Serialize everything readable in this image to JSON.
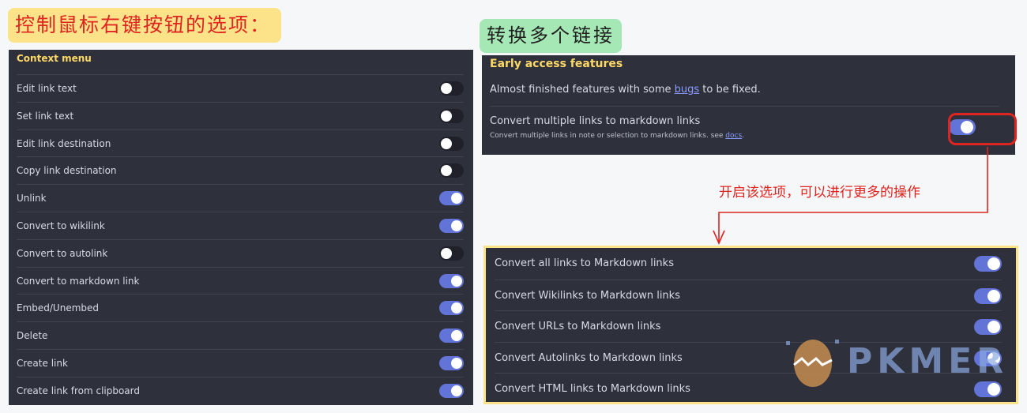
{
  "annotations": {
    "left_label": "控制鼠标右键按钮的选项：",
    "right_label": "转换多个链接",
    "arrow_note": "开启该选项，可以进行更多的操作"
  },
  "context_menu": {
    "title": "Context menu",
    "items": [
      {
        "label": "Edit link text",
        "enabled": false
      },
      {
        "label": "Set link text",
        "enabled": false
      },
      {
        "label": "Edit link destination",
        "enabled": false
      },
      {
        "label": "Copy link destination",
        "enabled": false
      },
      {
        "label": "Unlink",
        "enabled": true
      },
      {
        "label": "Convert to wikilink",
        "enabled": true
      },
      {
        "label": "Convert to autolink",
        "enabled": false
      },
      {
        "label": "Convert to markdown link",
        "enabled": true
      },
      {
        "label": "Embed/Unembed",
        "enabled": true
      },
      {
        "label": "Delete",
        "enabled": true
      },
      {
        "label": "Create link",
        "enabled": true
      },
      {
        "label": "Create link from clipboard",
        "enabled": true
      }
    ]
  },
  "early_access": {
    "title": "Early access features",
    "desc_before": "Almost finished features with some ",
    "desc_link": "bugs",
    "desc_after": " to be fixed.",
    "setting_name": "Convert multiple links to markdown links",
    "setting_sub_before": "Convert multiple links in note or selection to markdown links. see ",
    "setting_sub_link": "docs",
    "setting_sub_after": ".",
    "enabled": true
  },
  "convert_commands": {
    "items": [
      {
        "label": "Convert all links to Markdown links",
        "enabled": true
      },
      {
        "label": "Convert Wikilinks to Markdown links",
        "enabled": true
      },
      {
        "label": "Convert URLs to Markdown links",
        "enabled": true
      },
      {
        "label": "Convert Autolinks to Markdown links",
        "enabled": true
      },
      {
        "label": "Convert HTML links to Markdown links",
        "enabled": true
      }
    ]
  },
  "watermark": {
    "text": "PKMER"
  },
  "colors": {
    "accent": "#6374d8",
    "panel": "#2e303c",
    "highlight_red": "#e0241f",
    "title_yellow": "#ffd966"
  }
}
